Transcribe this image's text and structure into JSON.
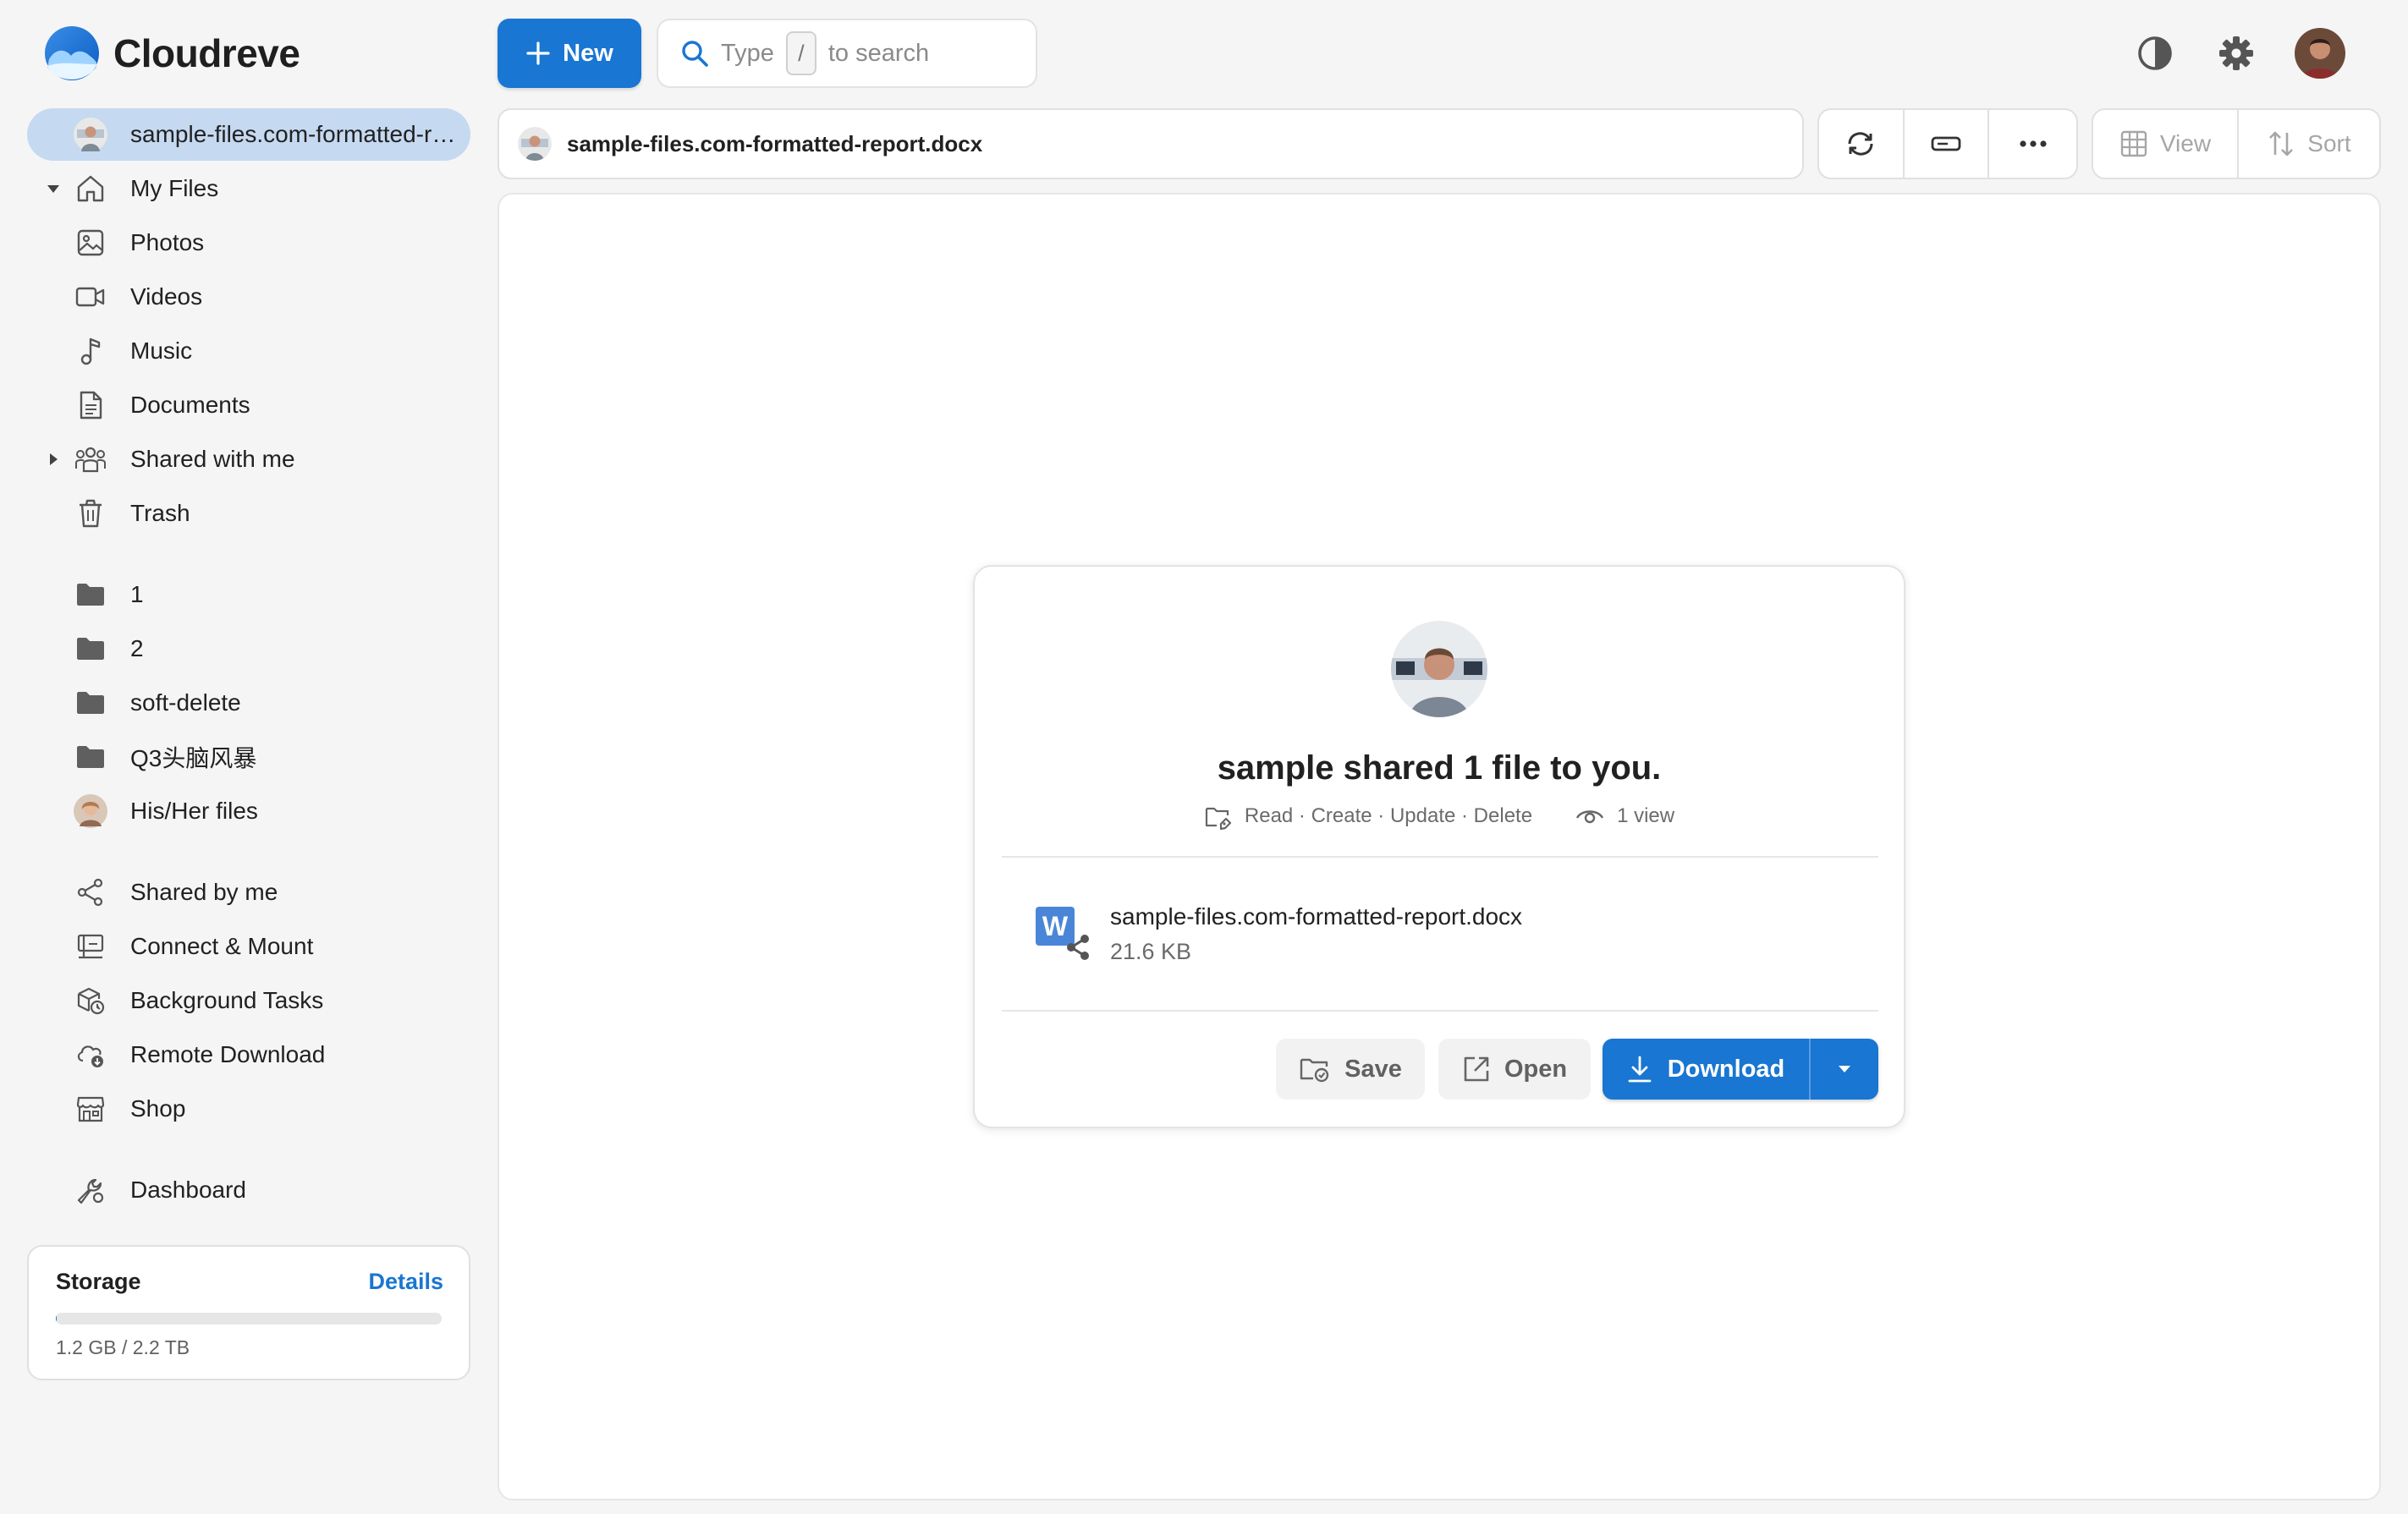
{
  "app": {
    "name": "Cloudreve"
  },
  "header": {
    "new_label": "New",
    "search_pre": "Type",
    "search_key": "/",
    "search_post": "to search"
  },
  "sidebar": {
    "active_item": "sample-files.com-formatted-report.docx",
    "items": [
      {
        "label": "My Files"
      },
      {
        "label": "Photos"
      },
      {
        "label": "Videos"
      },
      {
        "label": "Music"
      },
      {
        "label": "Documents"
      },
      {
        "label": "Shared with me"
      },
      {
        "label": "Trash"
      }
    ],
    "folders": [
      {
        "label": "1"
      },
      {
        "label": "2"
      },
      {
        "label": "soft-delete"
      },
      {
        "label": "Q3头脑风暴"
      },
      {
        "label": "His/Her files"
      }
    ],
    "tools": [
      {
        "label": "Shared by me"
      },
      {
        "label": "Connect & Mount"
      },
      {
        "label": "Background Tasks"
      },
      {
        "label": "Remote Download"
      },
      {
        "label": "Shop"
      }
    ],
    "dashboard_label": "Dashboard",
    "storage": {
      "title": "Storage",
      "details_label": "Details",
      "usage_text": "1.2 GB / 2.2 TB",
      "used_fraction": 0.0005
    }
  },
  "pathbar": {
    "filename": "sample-files.com-formatted-report.docx"
  },
  "toolbar": {
    "view_label": "View",
    "sort_label": "Sort"
  },
  "share": {
    "title": "sample shared 1 file to you.",
    "permissions": "Read · Create · Update · Delete",
    "views": "1 view",
    "file_name": "sample-files.com-formatted-report.docx",
    "file_size": "21.6 KB",
    "save_label": "Save",
    "open_label": "Open",
    "download_label": "Download"
  },
  "colors": {
    "accent": "#1976d2",
    "active_nav": "#c5d9f1",
    "word_blue": "#4a86d8"
  }
}
